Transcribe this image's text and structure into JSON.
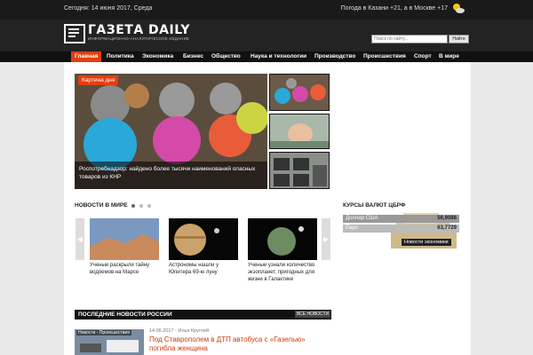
{
  "topbar": {
    "date": "Сегодня: 14 июня 2017, Среда",
    "weather": "Погода в Казани +21, а в Москве +17"
  },
  "header": {
    "title": "ГАЗЕТА DAILY",
    "subtitle": "ИНФОРМАЦИОННО-АНАЛИТИЧЕСКОЕ ИЗДАНИЕ",
    "search_placeholder": "Поиск по сайту...",
    "search_button": "Найти"
  },
  "nav": {
    "items": [
      {
        "label": "Главная"
      },
      {
        "label": "Политика"
      },
      {
        "label": "Экономика"
      },
      {
        "label": "Бизнес"
      },
      {
        "label": "Общество"
      },
      {
        "label": "Наука и технологии"
      },
      {
        "label": "Производство"
      },
      {
        "label": "Происшествия"
      },
      {
        "label": "Спорт"
      },
      {
        "label": "В мире"
      }
    ]
  },
  "hero": {
    "label": "Картина дня",
    "caption": "Роспотребнадзор: найдено более тысячи наименований опасных товаров из КНР"
  },
  "world": {
    "title": "НОВОСТИ В МИРЕ",
    "items": [
      {
        "caption": "Ученые раскрыли тайну водоемов на Марсе"
      },
      {
        "caption": "Астрономы нашли у Юпитера 69-ю луну"
      },
      {
        "caption": "Ученые узнали количество экзопланет, пригодных для жизни в Галактике"
      }
    ]
  },
  "rates": {
    "title": "КУРСЫ ВАЛЮТ ЦБРФ",
    "rows": [
      {
        "label": "Доллар США",
        "value": "56,9086"
      },
      {
        "label": "Евро",
        "value": "63,7729"
      }
    ],
    "button": "Новости экономики"
  },
  "russia": {
    "title": "ПОСЛЕДНИЕ НОВОСТИ РОССИИ",
    "all_button": "ВСЕ НОВОСТИ",
    "article": {
      "tag": "Новости - Происшествия",
      "meta": "14.06.2017 - Илья Круглей",
      "title": "Под Ставрополем в ДТП автобуса с «Газелью» погибла женщина"
    }
  }
}
